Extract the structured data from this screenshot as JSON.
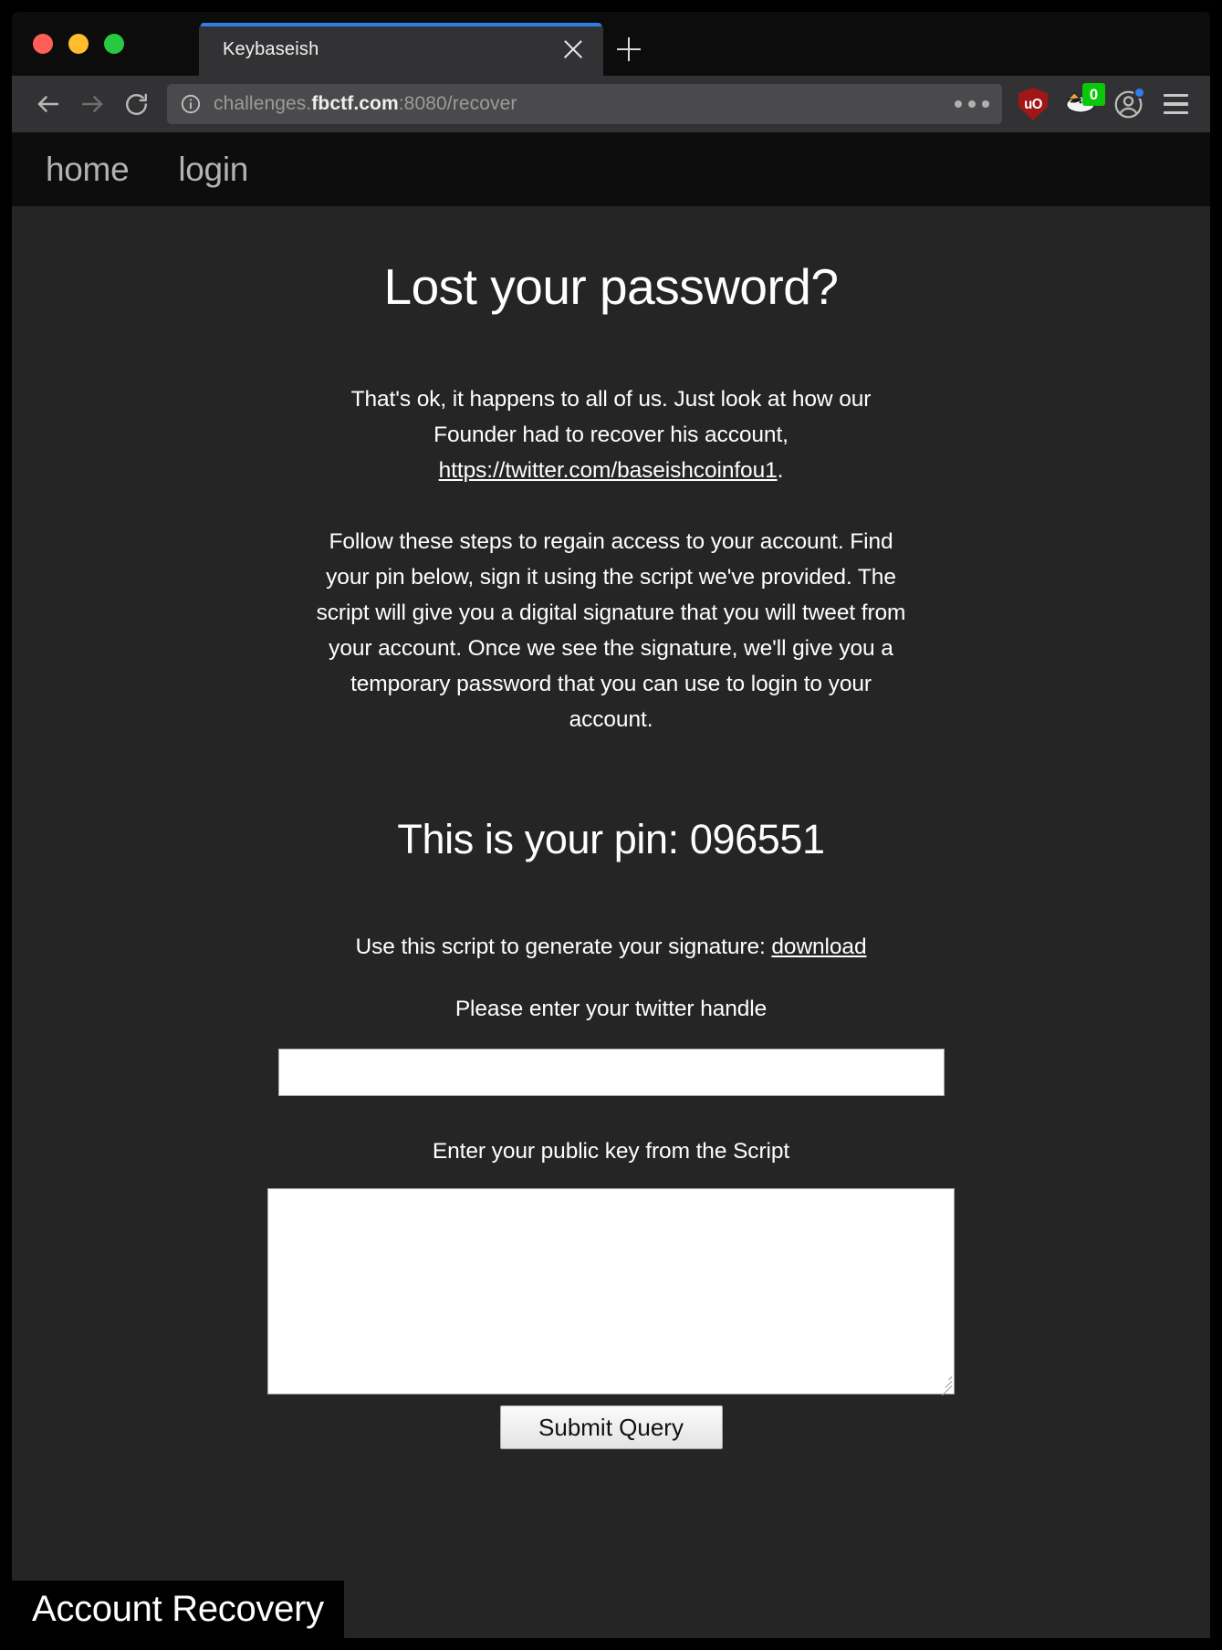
{
  "window": {
    "traffic_lights": [
      "close",
      "minimize",
      "maximize"
    ]
  },
  "browser": {
    "tab": {
      "title": "Keybaseish",
      "close_label": "×"
    },
    "new_tab_label": "+",
    "toolbar": {
      "back_label": "Back",
      "forward_label": "Forward",
      "reload_label": "Reload",
      "url_prefix": "challenges.",
      "url_domain": "fbctf.com",
      "url_suffix": ":8080/recover",
      "url_full": "challenges.fbctf.com:8080/recover",
      "page_actions_label": "•••",
      "ublock_label": "uO",
      "privacy_badger_label": "badger",
      "privacy_badger_count": "0",
      "account_label": "Account",
      "menu_label": "Menu"
    }
  },
  "site": {
    "nav": [
      {
        "label": "home"
      },
      {
        "label": "login"
      }
    ],
    "title": "Lost your password?",
    "paragraph1": {
      "before": "That's ok, it happens to all of us. Just look at how our Founder had to recover his account, ",
      "link": "https://twitter.com/baseishcoinfou1",
      "after": "."
    },
    "paragraph2": "Follow these steps to regain access to your account. Find your pin below, sign it using the script we've provided. The script will give you a digital signature that you will tweet from your account. Once we see the signature, we'll give you a temporary password that you can use to login to your account.",
    "pin_heading": "This is your pin: 096551",
    "pin_value": "096551",
    "script_line": {
      "text": "Use this script to generate your signature: ",
      "link": "download"
    },
    "form": {
      "handle_label": "Please enter your twitter handle",
      "handle_value": "",
      "handle_placeholder": "",
      "pubkey_label": "Enter your public key from the Script",
      "pubkey_value": "",
      "pubkey_placeholder": "",
      "submit_label": "Submit Query"
    },
    "statusbar": "Account Recovery"
  },
  "colors": {
    "page_bg": "#252525",
    "nav_bg": "#0d0d0d",
    "tab_accent": "#2f7fe8",
    "badge_green": "#0ac70a",
    "ublock_red": "#9f1717"
  }
}
